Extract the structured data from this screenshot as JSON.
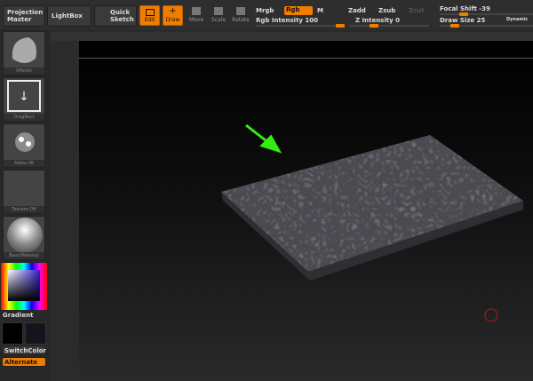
{
  "toolbar": {
    "projection_master": "Projection Master",
    "lightbox": "LightBox",
    "quick_sketch": "Quick Sketch",
    "edit": "Edit",
    "draw": "Draw",
    "move": "Move",
    "scale": "Scale",
    "rotate": "Rotate",
    "mrgb": "Mrgb",
    "rgb": "Rgb",
    "m": "M",
    "zadd": "Zadd",
    "zsub": "Zsub",
    "zcut": "Zcut",
    "rgb_intensity": "Rgb Intensity 100",
    "z_intensity": "Z Intensity 0",
    "focal_shift": "Focal Shift -39",
    "draw_size": "Draw Size 25",
    "dynamic": "Dynamic",
    "rgb_intensity_value": 100,
    "z_intensity_value": 0,
    "focal_shift_value": -39,
    "draw_size_value": 25
  },
  "left": {
    "brush": "hPolish",
    "stroke": "DragRect",
    "alpha": "Alpha 08",
    "texture": "Texture Off",
    "material": "BasicMaterial",
    "gradient": "Gradient",
    "switch_color": "SwitchColor",
    "alternate": "Alternate"
  },
  "colors": {
    "accent": "#f07d00",
    "arrow": "#33ee11",
    "cursor": "#cc1111"
  }
}
